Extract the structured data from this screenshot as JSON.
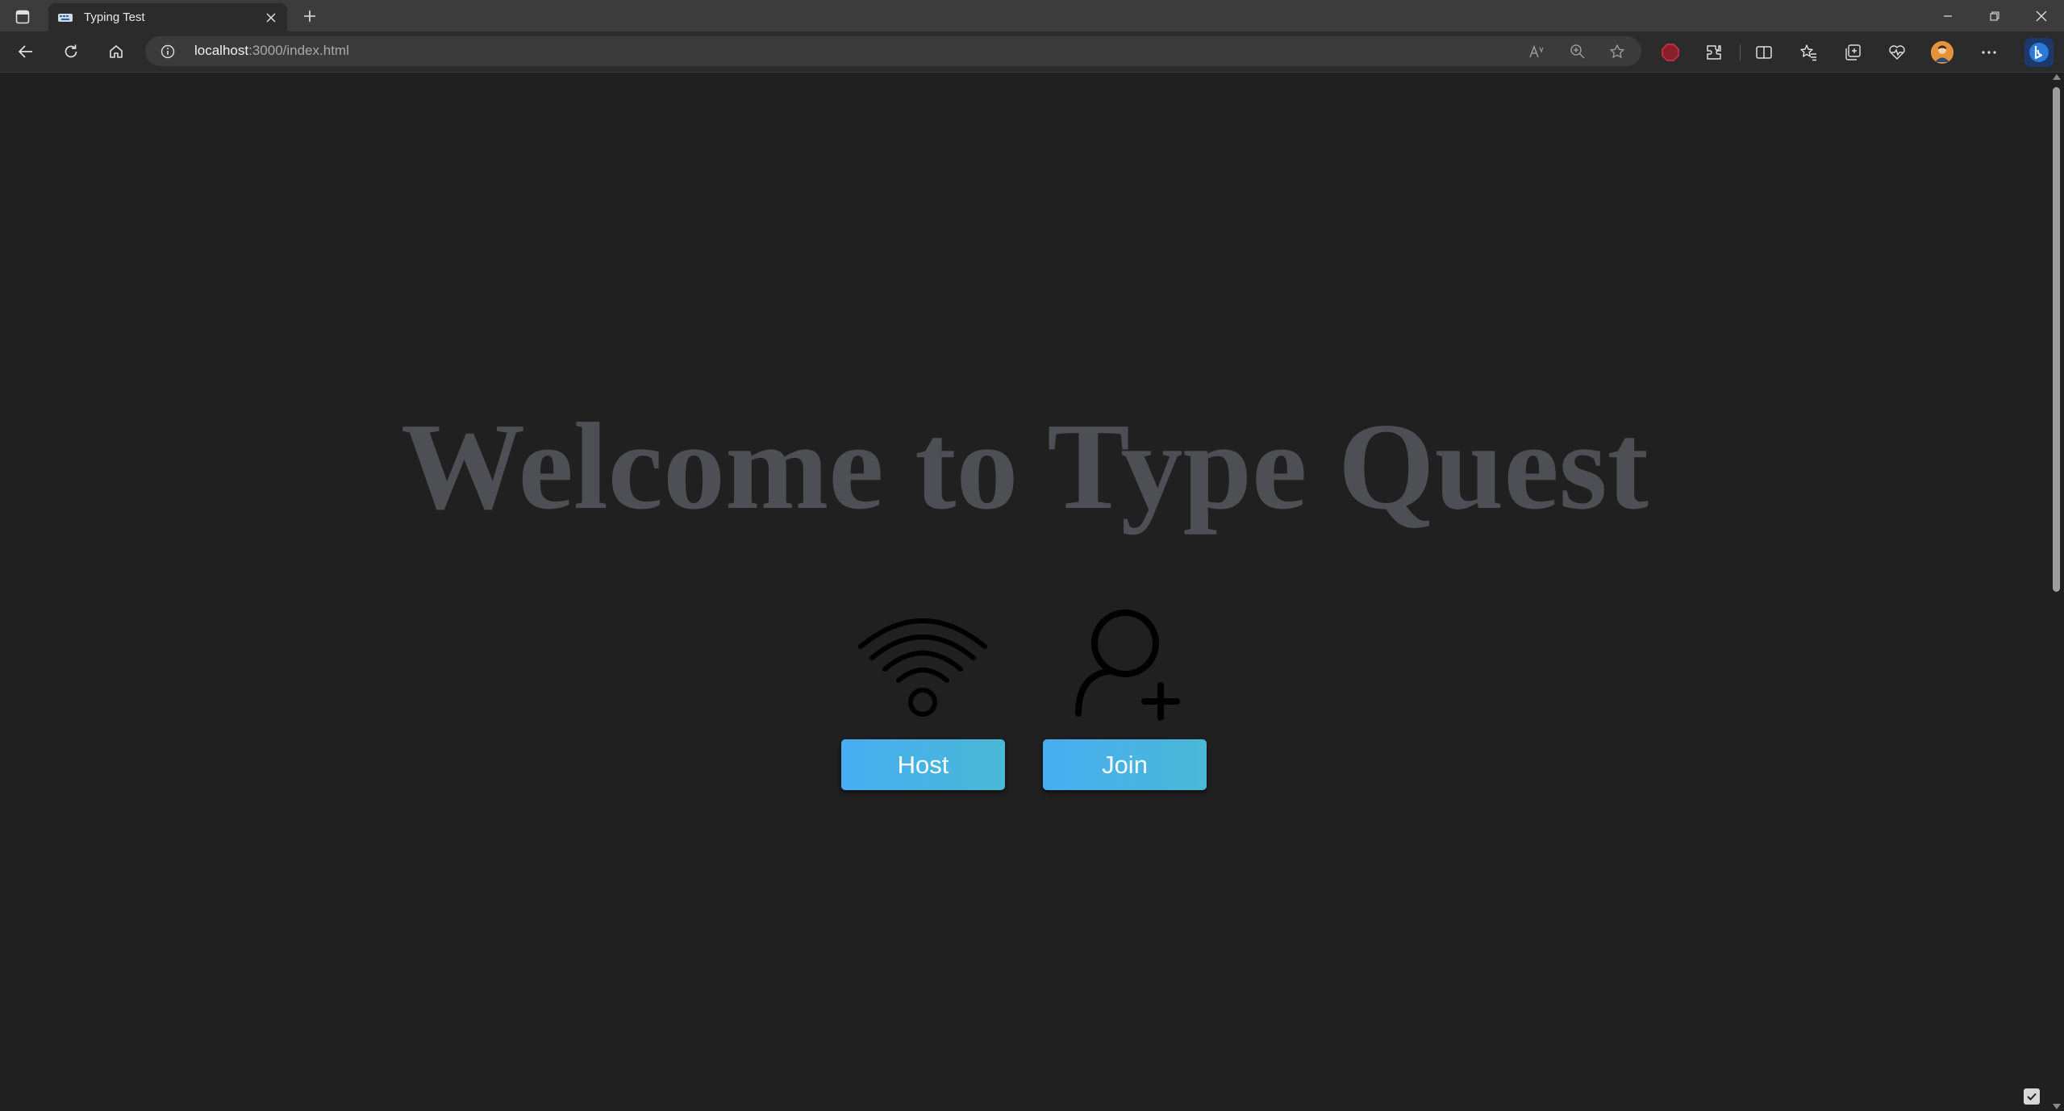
{
  "browser": {
    "tab": {
      "title": "Typing Test"
    },
    "address": {
      "host": "localhost",
      "rest": ":3000/index.html"
    }
  },
  "page": {
    "heading": "Welcome to Type Quest",
    "actions": [
      {
        "label": "Host",
        "icon": "wifi-icon"
      },
      {
        "label": "Join",
        "icon": "user-add-icon"
      }
    ]
  },
  "colors": {
    "background": "#202020",
    "heading": "#4d4f54",
    "button_gradient_start": "#47aef2",
    "button_gradient_end": "#4ab8d6",
    "button_text": "#ffffff"
  }
}
